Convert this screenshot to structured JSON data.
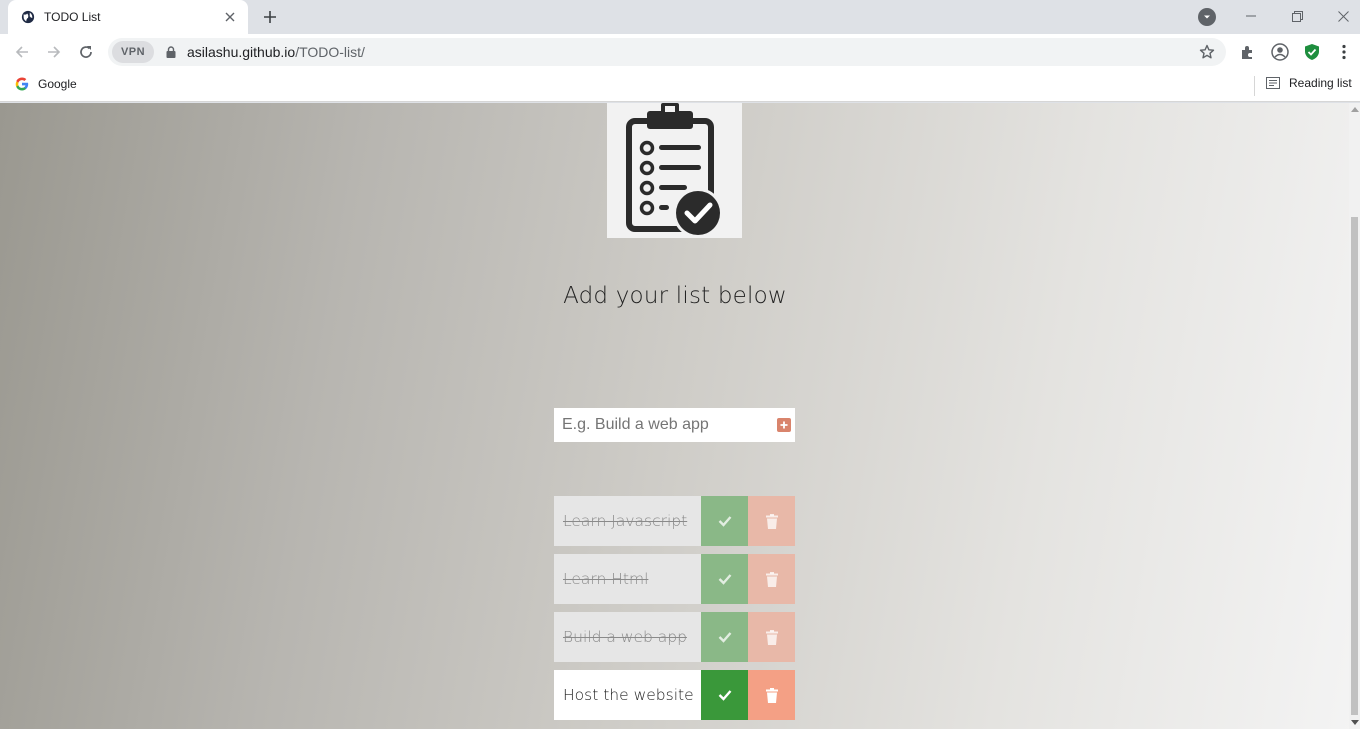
{
  "browser": {
    "tab": {
      "title": "TODO List",
      "favicon": "globe-icon"
    },
    "new_tab": "+",
    "vpn_label": "VPN",
    "url_host": "asilashu.github.io",
    "url_path": "/TODO-list/",
    "bookmarks": [
      {
        "label": "Google",
        "icon": "google-icon"
      }
    ],
    "reading_list_label": "Reading list"
  },
  "page": {
    "heading": "Add your list below",
    "input": {
      "placeholder": "E.g. Build a web app",
      "value": ""
    },
    "add_button_icon": "plus-square-icon",
    "todos": [
      {
        "text": "Learn Javascript",
        "completed": true
      },
      {
        "text": "Learn Html",
        "completed": true
      },
      {
        "text": "Build a web app",
        "completed": true
      },
      {
        "text": "Host the website",
        "completed": false
      }
    ],
    "colors": {
      "complete_done": "#8ab887",
      "complete_active": "#3a983a",
      "trash_done": "#e8b8a8",
      "trash_active": "#f4a085"
    }
  }
}
